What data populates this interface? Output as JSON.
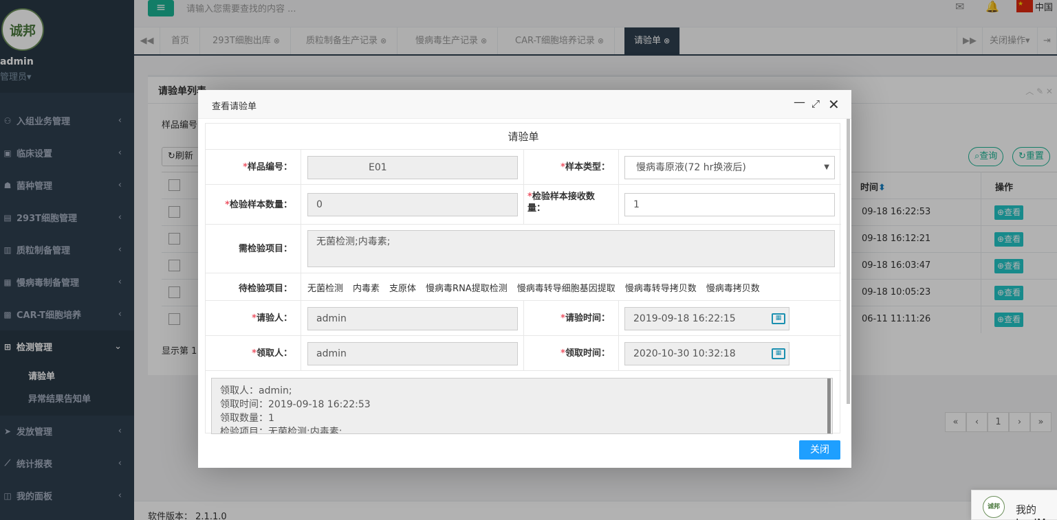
{
  "app": {
    "logo_text": "诚邦医疗",
    "version_label": "软件版本：",
    "version": "2.1.1.0"
  },
  "user": {
    "name": "admin",
    "role": "管理员▾"
  },
  "search": {
    "placeholder": "请输入您需要查找的内容 ..."
  },
  "top": {
    "mail_count": "",
    "notify_count": "",
    "language": "中国"
  },
  "sidebar": {
    "items": [
      {
        "icon": "users-icon",
        "glyph": "⚇",
        "label": "入组业务管理"
      },
      {
        "icon": "clinic-icon",
        "glyph": "▣",
        "label": "临床设置"
      },
      {
        "icon": "strain-icon",
        "glyph": "☗",
        "label": "菌种管理"
      },
      {
        "icon": "calendar-icon",
        "glyph": "▤",
        "label": "293T细胞管理"
      },
      {
        "icon": "map-icon",
        "glyph": "▥",
        "label": "质粒制备管理"
      },
      {
        "icon": "file-icon",
        "glyph": "▦",
        "label": "慢病毒制备管理"
      },
      {
        "icon": "briefcase-icon",
        "glyph": "▩",
        "label": "CAR-T细胞培养"
      },
      {
        "icon": "plus-square-icon",
        "glyph": "⊞",
        "label": "检测管理"
      },
      {
        "icon": "send-icon",
        "glyph": "➤",
        "label": "发放管理"
      },
      {
        "icon": "chart-icon",
        "glyph": "⟋",
        "label": "统计报表"
      },
      {
        "icon": "panel-icon",
        "glyph": "◫",
        "label": "我的面板"
      }
    ],
    "sub": [
      "请验单",
      "异常结果告知单"
    ]
  },
  "tabs": [
    {
      "label": "首页",
      "closable": false
    },
    {
      "label": "293T细胞出库",
      "closable": true
    },
    {
      "label": "质粒制备生产记录",
      "closable": true
    },
    {
      "label": "慢病毒生产记录",
      "closable": true
    },
    {
      "label": "CAR-T细胞培养记录",
      "closable": true
    },
    {
      "label": "请验单",
      "closable": true
    }
  ],
  "tab_actions": {
    "close_ops": "关闭操作▾"
  },
  "list": {
    "title": "请验单列表",
    "filter_label": "样品编号",
    "refresh": "刷新",
    "query": "查询",
    "reset": "重置",
    "col_time": "时间",
    "col_action": "操作",
    "rows": [
      {
        "time": "09-18 16:22:53",
        "action": "查看"
      },
      {
        "time": "09-18 16:12:21",
        "action": "查看"
      },
      {
        "time": "09-18 16:03:47",
        "action": "查看"
      },
      {
        "time": "09-18 10:05:23",
        "action": "查看"
      },
      {
        "time": "06-11 11:11:26",
        "action": "查看"
      }
    ],
    "showing": "显示第 1",
    "pager": [
      "«",
      "‹",
      "1",
      "›",
      "»"
    ]
  },
  "modal": {
    "title": "查看请验单",
    "form_title": "请验单",
    "sample_no_label": "样品编号：",
    "sample_no": "E01",
    "sample_type_label": "样本类型：",
    "sample_type": "慢病毒原液(72 hr换液后)",
    "sample_qty_label": "检验样本数量：",
    "sample_qty": "0",
    "recv_qty_label": "检验样本接收数量：",
    "recv_qty": "1",
    "need_items_label": "需检验项目：",
    "need_items": "无菌检测;内毒素;",
    "pending_label": "待检验项目：",
    "pending_items": [
      "无菌检测",
      "内毒素",
      "支原体",
      "慢病毒RNA提取检测",
      "慢病毒转导细胞基因提取",
      "慢病毒转导拷贝数",
      "慢病毒拷贝数"
    ],
    "requester_label": "请验人：",
    "requester": "admin",
    "request_time_label": "请验时间：",
    "request_time": "2019-09-18 16:22:15",
    "receiver_label": "领取人：",
    "receiver": "admin",
    "receive_time_label": "领取时间：",
    "receive_time": "2020-10-30 10:32:18",
    "log_lines": [
      "领取人：admin;",
      "领取时间：2019-09-18 16:22:53",
      "领取数量：1",
      "检验项目：无菌检测;内毒素;"
    ],
    "close": "关闭"
  },
  "layim": {
    "label": "我的LayIM"
  }
}
